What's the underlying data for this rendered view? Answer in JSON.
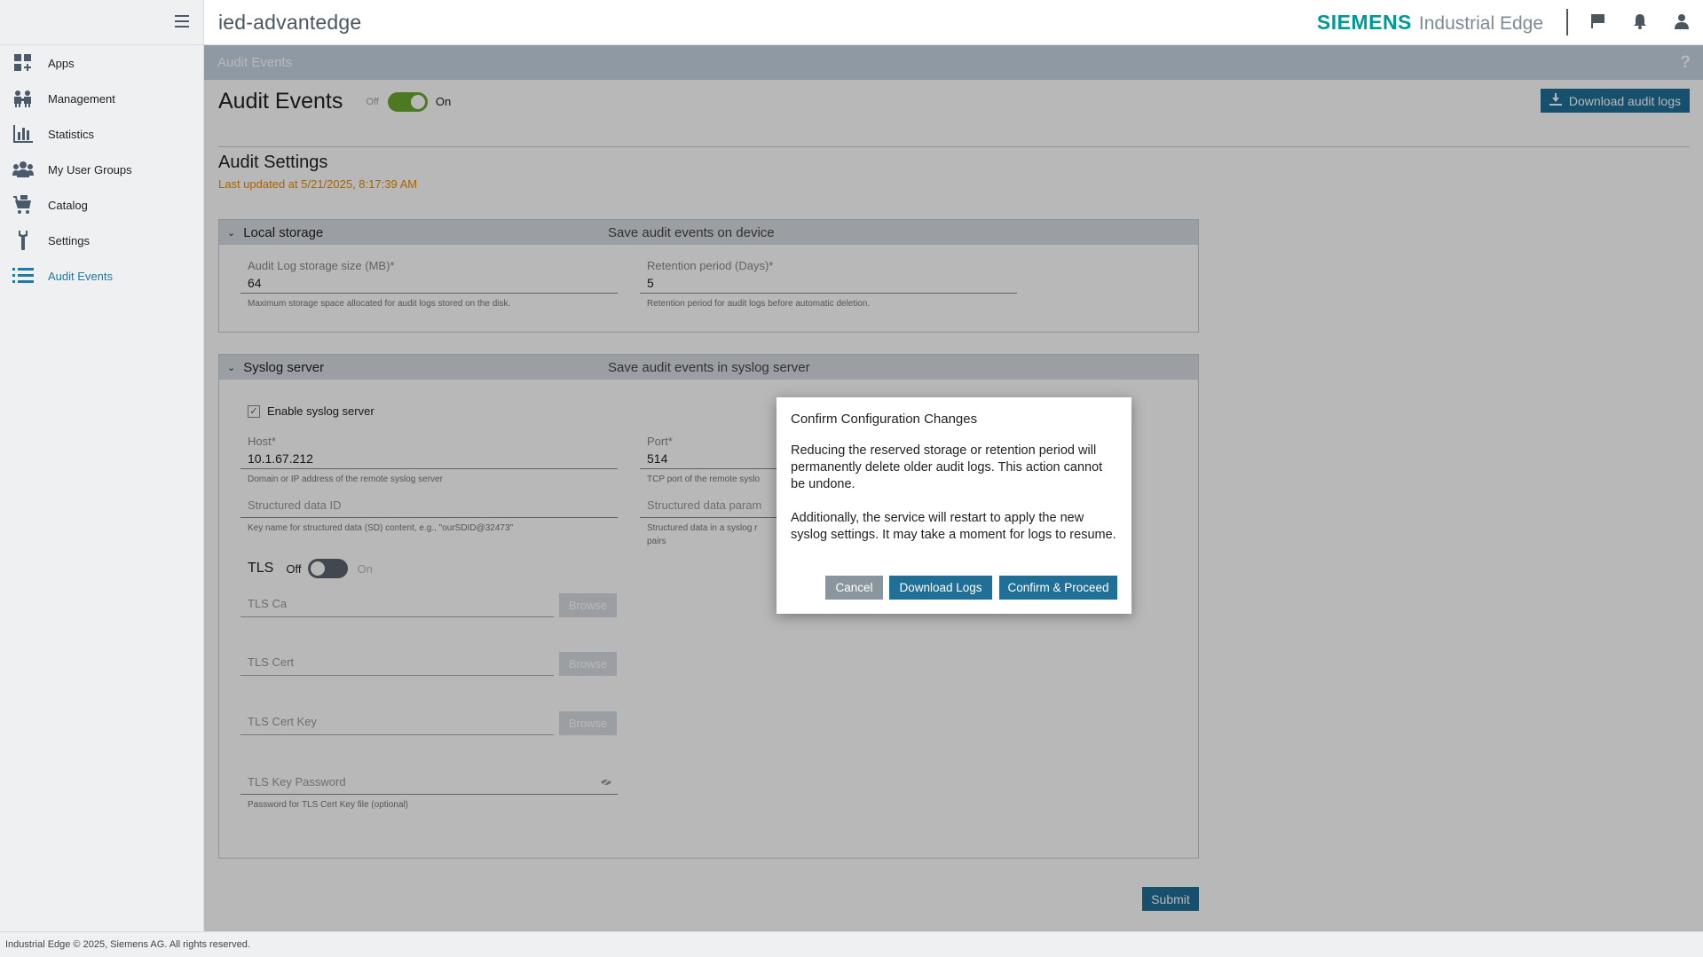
{
  "header": {
    "device_name": "ied-advantedge",
    "brand_name": "SIEMENS",
    "product_name": "Industrial Edge",
    "icons": [
      "menu-icon",
      "flag-icon",
      "bell-icon",
      "user-icon"
    ]
  },
  "sidebar": {
    "items": [
      {
        "label": "Apps",
        "icon": "apps-icon"
      },
      {
        "label": "Management",
        "icon": "management-icon"
      },
      {
        "label": "Statistics",
        "icon": "statistics-icon"
      },
      {
        "label": "My User Groups",
        "icon": "user-groups-icon"
      },
      {
        "label": "Catalog",
        "icon": "catalog-icon"
      },
      {
        "label": "Settings",
        "icon": "settings-icon"
      },
      {
        "label": "Audit Events",
        "icon": "audit-list-icon",
        "active": true
      }
    ]
  },
  "subheader": {
    "title": "Audit Events",
    "help": "?"
  },
  "main": {
    "title": "Audit Events",
    "toggle": {
      "off_label": "Off",
      "on_label": "On",
      "state": "on"
    },
    "download_label": "Download audit logs",
    "section_title": "Audit Settings",
    "last_updated": "Last updated at 5/21/2025, 8:17:39 AM",
    "local_storage": {
      "title": "Local storage",
      "description": "Save audit events on device",
      "storage_size": {
        "label": "Audit Log storage size (MB)*",
        "value": "64",
        "hint": "Maximum storage space allocated for audit logs stored on the disk."
      },
      "retention": {
        "label": "Retention period (Days)*",
        "value": "5",
        "hint": "Retention period for audit logs before automatic deletion."
      }
    },
    "syslog": {
      "title": "Syslog server",
      "description": "Save audit events in syslog server",
      "enable_label": "Enable syslog server",
      "enabled": true,
      "host": {
        "label": "Host*",
        "value": "10.1.67.212",
        "hint": "Domain or IP address of the remote syslog server"
      },
      "port": {
        "label": "Port*",
        "value": "514",
        "hint": "TCP port of the remote syslo"
      },
      "sd_id": {
        "placeholder": "Structured data ID",
        "hint": "Key name for structured data (SD) content, e.g., \"ourSDID@32473\""
      },
      "sd_param": {
        "placeholder": "Structured data param",
        "hint": "Structured data in a syslog r",
        "hint2": "pairs"
      },
      "tls": {
        "label": "TLS",
        "off_label": "Off",
        "on_label": "On",
        "state": "off"
      },
      "tls_ca": {
        "placeholder": "TLS Ca",
        "button": "Browse"
      },
      "tls_cert": {
        "placeholder": "TLS Cert",
        "button": "Browse"
      },
      "tls_cert_key": {
        "placeholder": "TLS Cert Key",
        "button": "Browse"
      },
      "tls_key_password": {
        "placeholder": "TLS Key Password",
        "hint": "Password for TLS Cert Key file (optional)"
      }
    },
    "submit_label": "Submit"
  },
  "modal": {
    "title": "Confirm Configuration Changes",
    "paragraph1": "Reducing the reserved storage or retention period will permanently delete older audit logs. This action cannot be undone.",
    "paragraph2": "Additionally, the service will restart to apply the new syslog settings. It may take a moment for logs to resume.",
    "cancel_label": "Cancel",
    "download_label": "Download Logs",
    "confirm_label": "Confirm & Proceed"
  },
  "footer": {
    "text": "Industrial Edge © 2025, Siemens AG. All rights reserved."
  },
  "colors": {
    "accent": "#1f6f96",
    "brand": "#009999",
    "toggle_on": "#6aa82f",
    "warning_text": "#e88a00"
  }
}
